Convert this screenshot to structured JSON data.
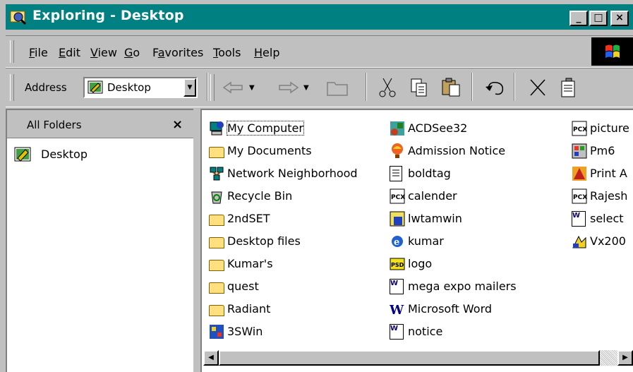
{
  "window": {
    "title": "Exploring - Desktop",
    "title_bar_color": "#008080",
    "buttons": {
      "minimize": "_",
      "maximize": "□",
      "close": "×"
    }
  },
  "menu": {
    "items": [
      {
        "label": "File",
        "key": "F",
        "rest": "ile"
      },
      {
        "label": "Edit",
        "key": "E",
        "rest": "dit"
      },
      {
        "label": "View",
        "key": "V",
        "rest": "iew"
      },
      {
        "label": "Go",
        "key": "G",
        "rest": "o"
      },
      {
        "label": "Favorites",
        "key": "a",
        "pre": "F",
        "rest": "vorites"
      },
      {
        "label": "Tools",
        "key": "T",
        "rest": "ools"
      },
      {
        "label": "Help",
        "key": "H",
        "rest": "elp"
      }
    ]
  },
  "toolbar": {
    "address_label": "Address",
    "address_value": "Desktop",
    "buttons": [
      "back",
      "forward",
      "up",
      "cut",
      "copy",
      "paste",
      "undo",
      "delete",
      "properties"
    ]
  },
  "left_pane": {
    "title": "All Folders",
    "close": "×",
    "tree": [
      {
        "label": "Desktop",
        "icon": "desktop-icon"
      }
    ]
  },
  "files": {
    "col1": [
      {
        "label": "My Computer",
        "icon": "my-computer-icon"
      },
      {
        "label": "My Documents",
        "icon": "my-documents-icon"
      },
      {
        "label": "Network Neighborhood",
        "icon": "network-icon"
      },
      {
        "label": "Recycle Bin",
        "icon": "recycle-bin-icon"
      },
      {
        "label": "2ndSET",
        "icon": "folder-icon"
      },
      {
        "label": "Desktop files",
        "icon": "folder-icon"
      },
      {
        "label": "Kumar's",
        "icon": "folder-icon"
      },
      {
        "label": "quest",
        "icon": "folder-icon"
      },
      {
        "label": "Radiant",
        "icon": "folder-icon"
      },
      {
        "label": "3SWin",
        "icon": "app-shortcut-icon"
      }
    ],
    "col2": [
      {
        "label": "ACDSee32",
        "icon": "acdsee-icon"
      },
      {
        "label": "Admission Notice",
        "icon": "balloon-icon"
      },
      {
        "label": "boldtag",
        "icon": "text-doc-icon"
      },
      {
        "label": "calender",
        "icon": "pcx-icon"
      },
      {
        "label": "lwtamwin",
        "icon": "tamil-app-icon"
      },
      {
        "label": "kumar",
        "icon": "ie-icon"
      },
      {
        "label": "logo",
        "icon": "psd-icon"
      },
      {
        "label": "mega expo mailers",
        "icon": "word-doc-icon"
      },
      {
        "label": "Microsoft Word",
        "icon": "word-app-icon"
      },
      {
        "label": "notice",
        "icon": "word-doc-icon"
      }
    ],
    "col3": [
      {
        "label": "picture",
        "icon": "pcx-icon"
      },
      {
        "label": "Pm6",
        "icon": "pm-icon"
      },
      {
        "label": "Print A",
        "icon": "print-icon"
      },
      {
        "label": "Rajesh",
        "icon": "pcx-icon"
      },
      {
        "label": "select",
        "icon": "word-doc-icon"
      },
      {
        "label": "Vx200",
        "icon": "vx-icon"
      }
    ]
  }
}
